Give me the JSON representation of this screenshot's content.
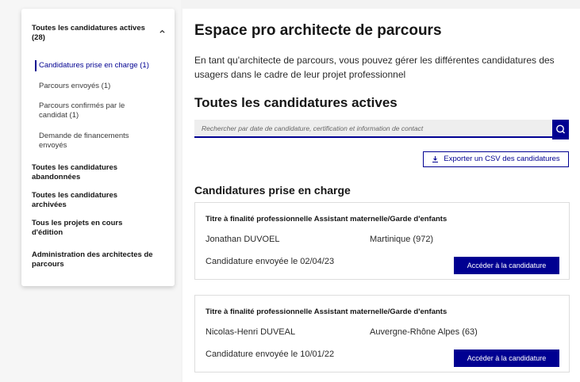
{
  "sidebar": {
    "title": "Toutes les candidatures actives (28)",
    "subitems": [
      {
        "label": "Candidatures prise en charge (1)"
      },
      {
        "label": "Parcours envoyés (1)"
      },
      {
        "label": "Parcours confirmés par le candidat (1)"
      },
      {
        "label": "Demande de financements envoyés"
      }
    ],
    "items": [
      {
        "label": "Toutes les candidatures abandonnées"
      },
      {
        "label": "Toutes les candidatures archivées"
      },
      {
        "label": "Tous les projets en cours d'édition"
      },
      {
        "label": "Administration des architectes de parcours"
      }
    ]
  },
  "main": {
    "title": "Espace pro architecte de parcours",
    "intro": "En tant qu'architecte de parcours, vous pouvez gérer les différentes candidatures des usagers dans le cadre de leur projet professionnel",
    "section_title": "Toutes les candidatures actives",
    "search_placeholder": "Rechercher par date de candidature, certification et information de contact",
    "export_label": "Exporter un CSV des candidatures",
    "list_title": "Candidatures prise en charge",
    "cards": [
      {
        "title": "Titre à finalité professionnelle Assistant maternelle/Garde d'enfants",
        "name": "Jonathan DUVOEL",
        "region": "Martinique (972)",
        "date": "Candidature envoyée le 02/04/23",
        "button": "Accéder à la candidature"
      },
      {
        "title": "Titre à finalité professionnelle Assistant maternelle/Garde d'enfants",
        "name": "Nicolas-Henri DUVEAL",
        "region": "Auvergne-Rhône Alpes (63)",
        "date": "Candidature envoyée le 10/01/22",
        "button": "Accéder à la candidature"
      }
    ]
  },
  "colors": {
    "accent": "#000091"
  }
}
